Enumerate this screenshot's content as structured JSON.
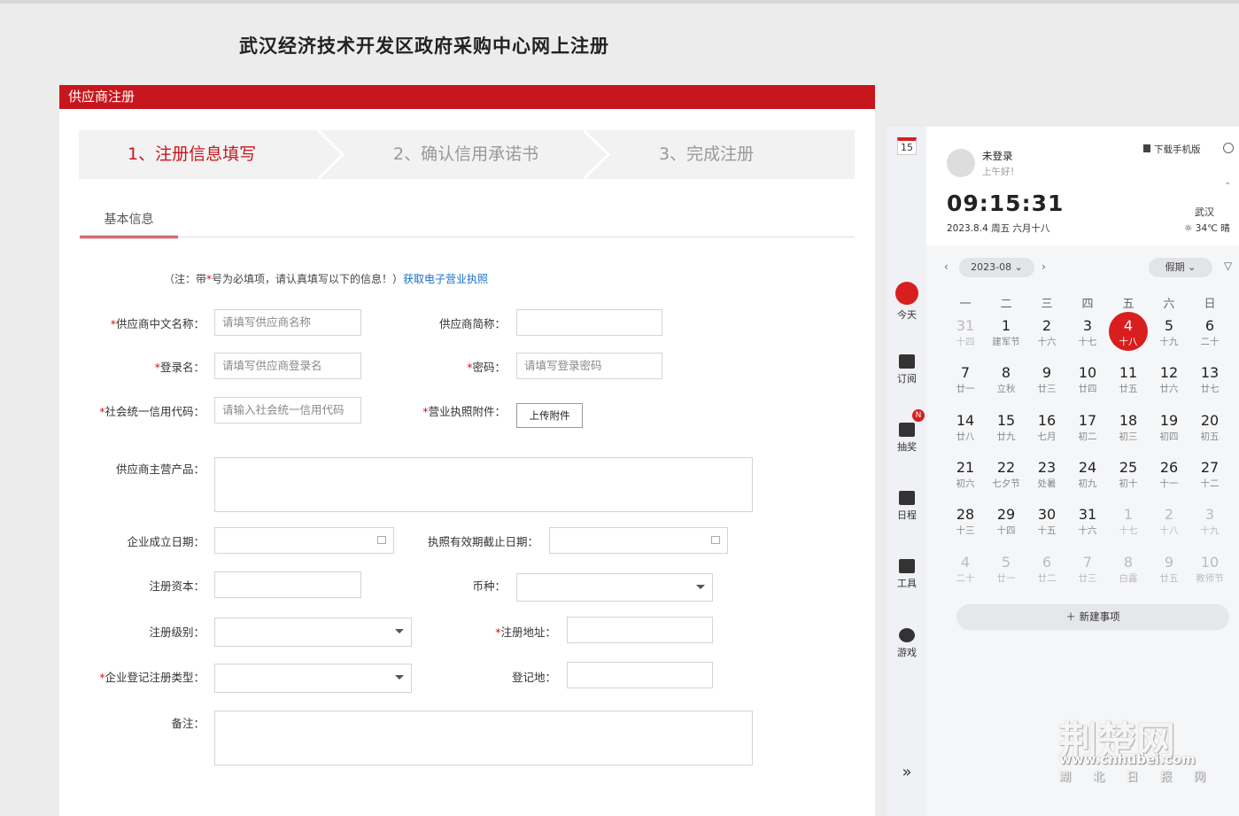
{
  "page_title": "武汉经济技术开发区政府采购中心网上注册",
  "panel_title": "供应商注册",
  "steps": [
    "1、注册信息填写",
    "2、确认信用承诺书",
    "3、完成注册"
  ],
  "tab": "基本信息",
  "note": {
    "prefix": "（注：带",
    "star": "*",
    "suffix": "号为必填项，请认真填写以下的信息！）",
    "link": "获取电子营业执照"
  },
  "form": {
    "cn_name_label": "供应商中文名称：",
    "cn_name_placeholder": "请填写供应商名称",
    "short_name_label": "供应商简称：",
    "login_label": "登录名：",
    "login_placeholder": "请填写供应商登录名",
    "password_label": "密码：",
    "password_placeholder": "请填写登录密码",
    "credit_code_label": "社会统一信用代码：",
    "credit_code_placeholder": "请输入社会统一信用代码",
    "license_label": "营业执照附件：",
    "upload_button": "上传附件",
    "products_label": "供应商主营产品：",
    "found_date_label": "企业成立日期：",
    "license_expiry_label": "执照有效期截止日期：",
    "capital_label": "注册资本：",
    "currency_label": "币种：",
    "level_label": "注册级别：",
    "address_label": "注册地址：",
    "reg_type_label": "企业登记注册类型：",
    "reg_place_label": "登记地：",
    "remark_label": "备注："
  },
  "side": {
    "date_badge": "15",
    "user": "未登录",
    "greeting": "上午好！",
    "download": "下载手机版",
    "time": "09:15:31",
    "date_line": "2023.8.4 周五 六月十八",
    "city": "武汉",
    "weather": "34℃ 晴",
    "month": "2023-08",
    "holiday": "假期",
    "nav": [
      {
        "label": "今天",
        "icon": "today-icon"
      },
      {
        "label": "订阅",
        "icon": "subscribe-icon"
      },
      {
        "label": "抽奖",
        "icon": "lottery-icon"
      },
      {
        "label": "日程",
        "icon": "schedule-icon"
      },
      {
        "label": "工具",
        "icon": "tools-icon"
      },
      {
        "label": "游戏",
        "icon": "game-icon"
      }
    ],
    "badge": "N",
    "weekdays": [
      "一",
      "二",
      "三",
      "四",
      "五",
      "六",
      "日"
    ],
    "weeks": [
      [
        [
          "31",
          "十四",
          1
        ],
        [
          "1",
          "建军节",
          0
        ],
        [
          "2",
          "十六",
          0
        ],
        [
          "3",
          "十七",
          0
        ],
        [
          "4",
          "十八",
          2
        ],
        [
          "5",
          "十九",
          0
        ],
        [
          "6",
          "二十",
          0
        ]
      ],
      [
        [
          "7",
          "廿一",
          0
        ],
        [
          "8",
          "立秋",
          0
        ],
        [
          "9",
          "廿三",
          0
        ],
        [
          "10",
          "廿四",
          0
        ],
        [
          "11",
          "廿五",
          0
        ],
        [
          "12",
          "廿六",
          0
        ],
        [
          "13",
          "廿七",
          0
        ]
      ],
      [
        [
          "14",
          "廿八",
          0
        ],
        [
          "15",
          "廿九",
          0
        ],
        [
          "16",
          "七月",
          0
        ],
        [
          "17",
          "初二",
          0
        ],
        [
          "18",
          "初三",
          0
        ],
        [
          "19",
          "初四",
          0
        ],
        [
          "20",
          "初五",
          0
        ]
      ],
      [
        [
          "21",
          "初六",
          0
        ],
        [
          "22",
          "七夕节",
          0
        ],
        [
          "23",
          "处暑",
          0
        ],
        [
          "24",
          "初九",
          0
        ],
        [
          "25",
          "初十",
          0
        ],
        [
          "26",
          "十一",
          0
        ],
        [
          "27",
          "十二",
          0
        ]
      ],
      [
        [
          "28",
          "十三",
          0
        ],
        [
          "29",
          "十四",
          0
        ],
        [
          "30",
          "十五",
          0
        ],
        [
          "31",
          "十六",
          0
        ],
        [
          "1",
          "十七",
          1
        ],
        [
          "2",
          "十八",
          1
        ],
        [
          "3",
          "十九",
          1
        ]
      ],
      [
        [
          "4",
          "二十",
          1
        ],
        [
          "5",
          "廿一",
          1
        ],
        [
          "6",
          "廿二",
          1
        ],
        [
          "7",
          "廿三",
          1
        ],
        [
          "8",
          "白露",
          1
        ],
        [
          "9",
          "廿五",
          1
        ],
        [
          "10",
          "教师节",
          1
        ]
      ]
    ],
    "new_event": "＋  新建事项",
    "expand": "»"
  },
  "watermark": {
    "logo": "荆楚网",
    "url": "www.cnhubei.com",
    "sub": "湖北日报网"
  }
}
